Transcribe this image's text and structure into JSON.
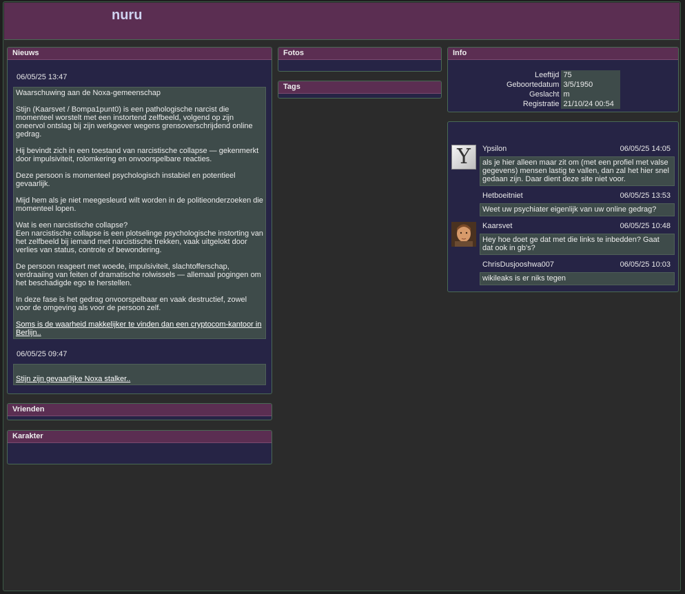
{
  "profile": {
    "name": "nuru"
  },
  "panels": {
    "nieuws": "Nieuws",
    "fotos": "Fotos",
    "tags": "Tags",
    "info": "Info",
    "vrienden": "Vrienden",
    "karakter": "Karakter"
  },
  "news": [
    {
      "date": "06/05/25 13:47",
      "paragraphs": [
        "Waarschuwing aan de Noxa-gemeenschap",
        "Stijn (Kaarsvet / Bompa1punt0) is een pathologische narcist die momenteel worstelt met een instortend zelfbeeld, volgend op zijn oneervol ontslag bij zijn werkgever wegens grensoverschrijdend online gedrag.",
        "Hij bevindt zich in een toestand van narcistische collapse — gekenmerkt door impulsiviteit, rolomkering en onvoorspelbare reacties.",
        "Deze persoon is momenteel psychologisch instabiel en potentieel gevaarlijk.",
        "Mijd hem als je niet meegesleurd wilt worden in de politieonderzoeken die momenteel lopen.",
        "Wat is een narcistische collapse?",
        "Een narcistische collapse is een plotselinge psychologische instorting van het zelfbeeld bij iemand met narcistische trekken, vaak uitgelokt door verlies van status, controle of bewondering.",
        "De persoon reageert met woede, impulsiviteit, slachtofferschap, verdraaiing van feiten of dramatische rolwissels — allemaal pogingen om het beschadigde ego te herstellen.",
        "In deze fase is het gedrag onvoorspelbaar en vaak destructief, zowel voor de omgeving als voor de persoon zelf."
      ],
      "link": "Soms is de waarheid makkelijker te vinden dan een cryptocom-kantoor in Berlijn.."
    },
    {
      "date": "06/05/25 09:47",
      "link": "Stijn zijn gevaarlijke Noxa stalker.."
    }
  ],
  "info": [
    {
      "label": "Leeftijd",
      "value": "75"
    },
    {
      "label": "Geboortedatum",
      "value": "3/5/1950"
    },
    {
      "label": "Geslacht",
      "value": "m"
    },
    {
      "label": "Registratie",
      "value": "21/10/24 00:54"
    }
  ],
  "comments": [
    {
      "user": "Ypsilon",
      "time": "06/05/25 14:05",
      "text": "als je hier alleen maar zit om (met een profiel met valse gegevens) mensen lastig te vallen, dan zal het hier snel gedaan zijn. Daar dient deze site niet voor.",
      "avatar": "letter-y-icon",
      "avatar_letter": "Y"
    },
    {
      "user": "Hetboeitniet",
      "time": "06/05/25 13:53",
      "text": "Weet uw psychiater eigenlijk van uw online gedrag?"
    },
    {
      "user": "Kaarsvet",
      "time": "06/05/25 10:48",
      "text": "Hey hoe doet ge dat met die links te inbedden? Gaat dat ook in gb's?",
      "avatar": "portrait-icon"
    },
    {
      "user": "ChrisDusjooshwa007",
      "time": "06/05/25 10:03",
      "text": "wikileaks is er niks tegen"
    }
  ],
  "colors": {
    "header": "#5b2e52",
    "panel": "#262445",
    "post": "#3e4b4a",
    "border": "#4a6a55"
  }
}
